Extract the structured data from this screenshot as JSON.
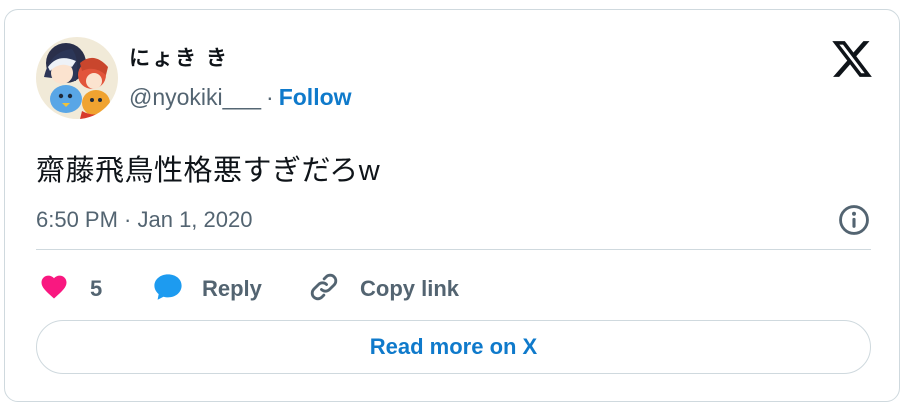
{
  "author": {
    "display_name": "にょき き",
    "handle": "@nyokiki___",
    "separator": "·",
    "follow_label": "Follow"
  },
  "tweet": {
    "text": "齋藤飛鳥性格悪すぎだろw",
    "timestamp": "6:50 PM · Jan 1, 2020"
  },
  "actions": {
    "like_count": "5",
    "reply_label": "Reply",
    "copy_link_label": "Copy link"
  },
  "read_more_label": "Read more on X",
  "colors": {
    "link_blue": "#0f7acb",
    "like_pink": "#f91880",
    "reply_blue": "#1d9bf0",
    "muted_gray": "#536471",
    "border": "#cfd9de"
  },
  "icons": {
    "logo": "x-logo-icon",
    "info": "info-icon",
    "like": "heart-icon",
    "reply": "speech-bubble-icon",
    "copy": "link-icon"
  }
}
